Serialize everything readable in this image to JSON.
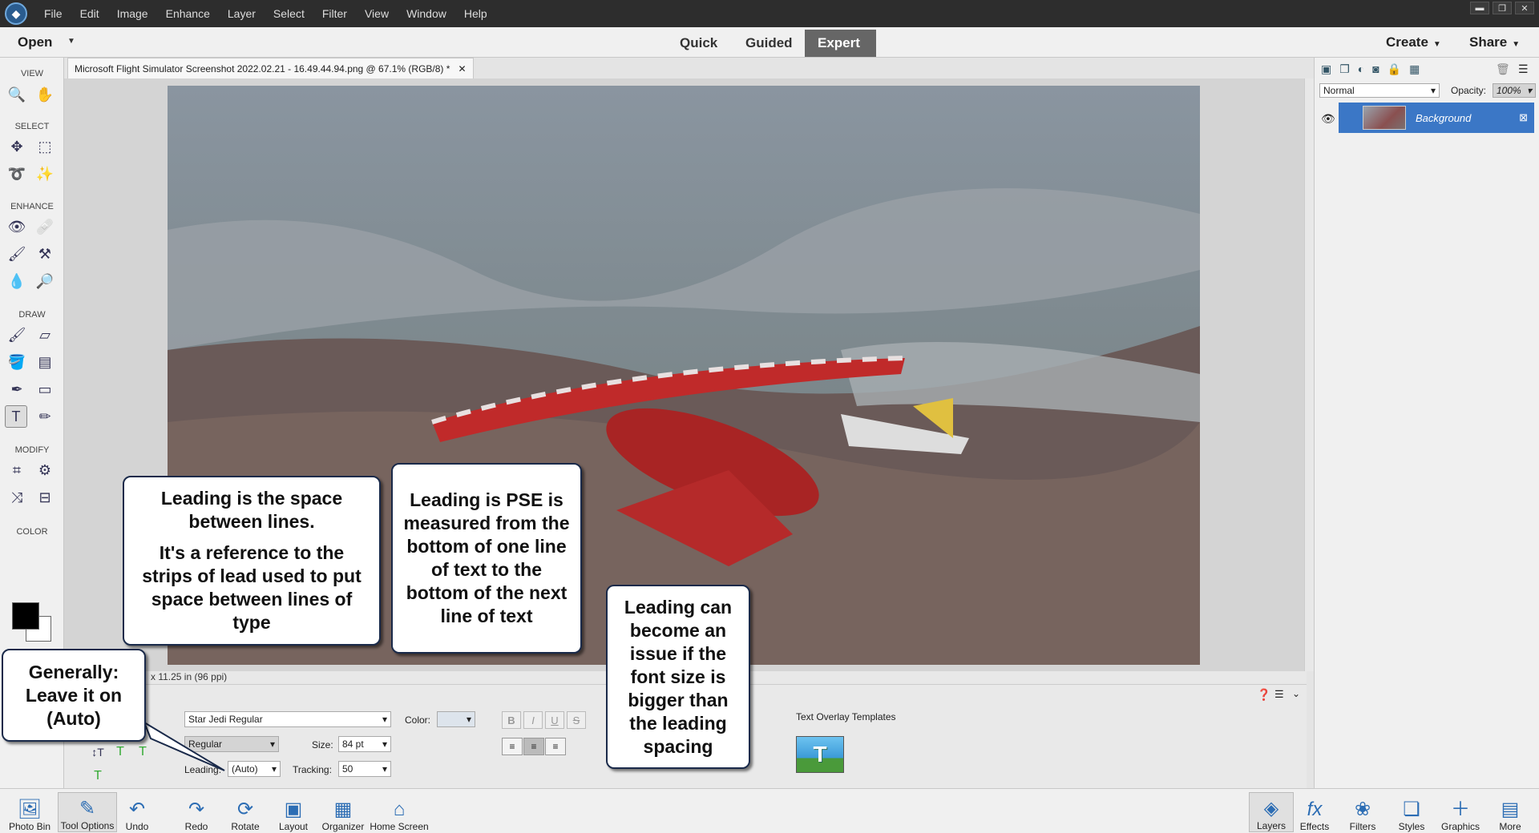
{
  "menubar": {
    "items": [
      "File",
      "Edit",
      "Image",
      "Enhance",
      "Layer",
      "Select",
      "Filter",
      "View",
      "Window",
      "Help"
    ]
  },
  "modebar": {
    "open": "Open",
    "tabs": [
      "Quick",
      "Guided",
      "Expert"
    ],
    "active_tab": "Expert",
    "create": "Create",
    "share": "Share"
  },
  "toolbox": {
    "sections": [
      "VIEW",
      "SELECT",
      "ENHANCE",
      "DRAW",
      "MODIFY",
      "COLOR"
    ]
  },
  "document": {
    "tab_title": "Microsoft Flight Simulator Screenshot 2022.02.21 - 16.49.44.94.png @ 67.1% (RGB/8) *",
    "status": "x 11.25 in (96 ppi)"
  },
  "layers": {
    "blend_mode": "Normal",
    "opacity_label": "Opacity:",
    "opacity_value": "100%",
    "layer_name": "Background"
  },
  "tool_options": {
    "font_family": "Star Jedi Regular",
    "font_style": "Regular",
    "color_label": "Color:",
    "size_label": "Size:",
    "size_value": "84 pt",
    "leading_label": "Leading:",
    "leading_value": "(Auto)",
    "tracking_label": "Tracking:",
    "tracking_value": "50",
    "format_buttons": [
      "B",
      "I",
      "U",
      "S"
    ],
    "overlay_title": "Text Overlay Templates"
  },
  "bottom_bar": {
    "left": [
      "Photo Bin",
      "Tool Options",
      "Undo",
      "Redo",
      "Rotate",
      "Layout",
      "Organizer",
      "Home Screen"
    ],
    "right": [
      "Layers",
      "Effects",
      "Filters",
      "Styles",
      "Graphics",
      "More"
    ]
  },
  "callouts": {
    "c1_p1": "Leading is the space between lines.",
    "c1_p2": "It's a reference to the strips of lead used to put space between lines of type",
    "c2": "Leading is PSE is measured from the bottom of one line of text to the bottom of the next line of text",
    "c3": "Leading can become an issue if the font size is bigger than the leading spacing",
    "c4": "Generally: Leave it on (Auto)"
  },
  "colors": {
    "accent": "#3b77c6",
    "menubar": "#2d2d2d",
    "active_mode": "#666666"
  }
}
